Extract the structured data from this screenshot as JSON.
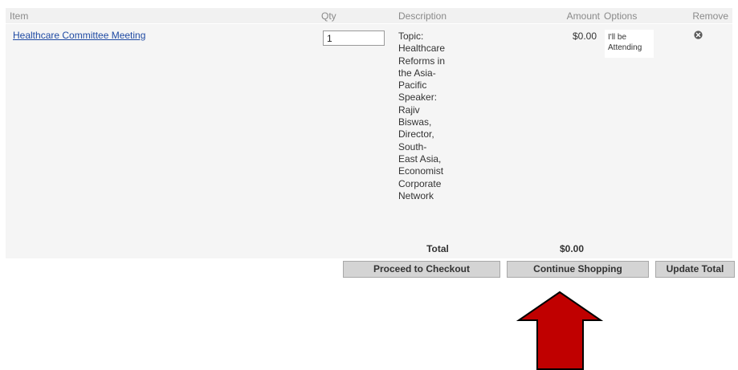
{
  "table": {
    "headers": {
      "item": "Item",
      "qty": "Qty",
      "description": "Description",
      "amount": "Amount",
      "options": "Options",
      "remove": "Remove"
    },
    "rows": [
      {
        "item": "Healthcare Committee Meeting",
        "qty": "1",
        "description_lines": [
          "Topic:",
          "Healthcare",
          "Reforms in",
          "the Asia-",
          "Pacific",
          "Speaker:",
          "Rajiv",
          "Biswas,",
          "Director,",
          "South-",
          "East Asia,",
          "Economist",
          "Corporate",
          "Network"
        ],
        "amount": "$0.00",
        "option_lines": [
          "I'll be",
          "Attending"
        ],
        "remove_icon": "close-circle-icon"
      }
    ],
    "total_label": "Total",
    "total_value": "$0.00"
  },
  "buttons": {
    "checkout": "Proceed to Checkout",
    "continue": "Continue Shopping",
    "update": "Update Total"
  },
  "annotation": {
    "arrow_color": "#c00000",
    "arrow_outline": "#000000"
  }
}
